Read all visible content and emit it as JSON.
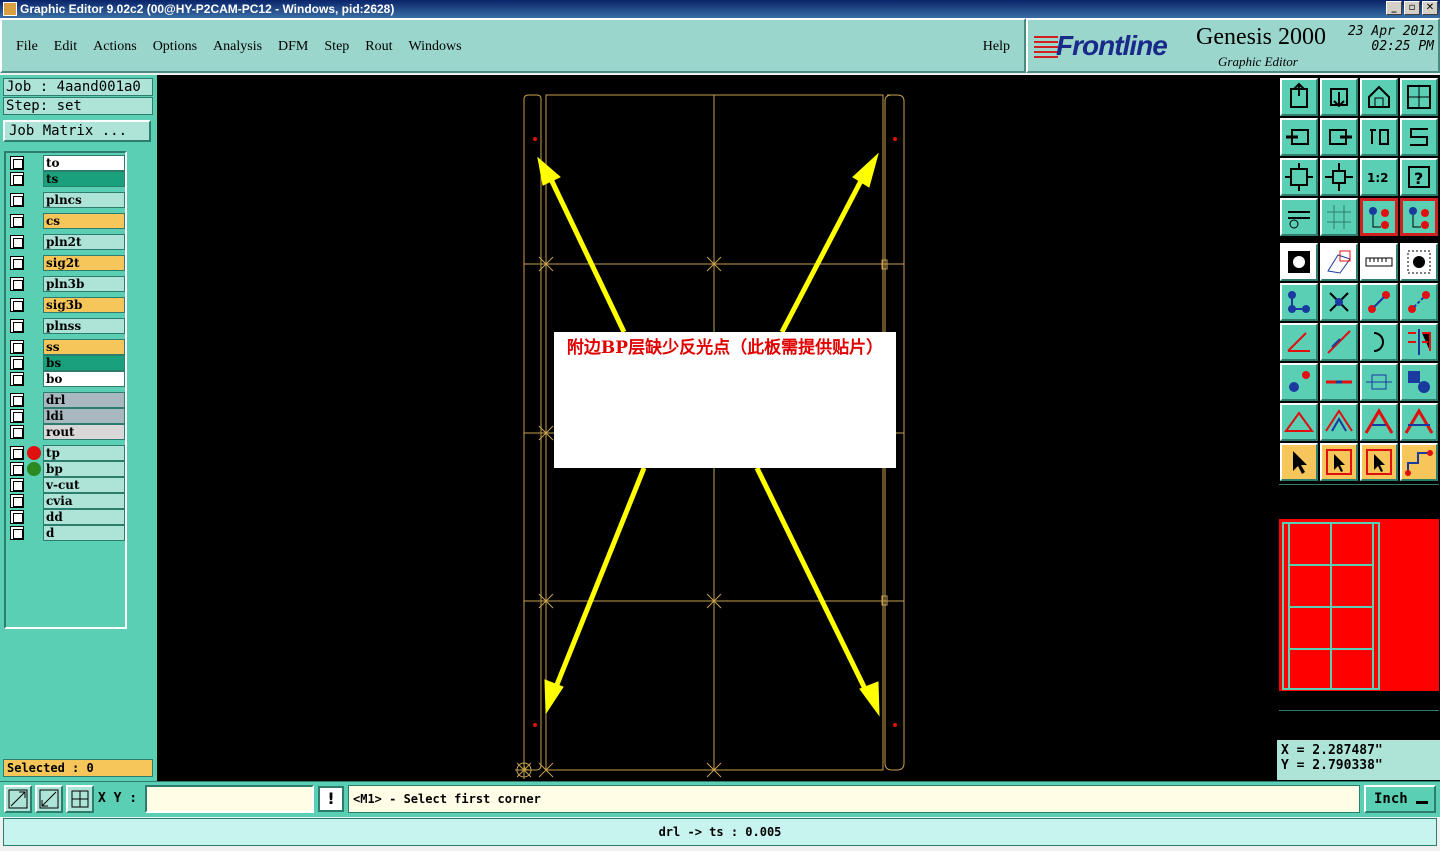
{
  "window": {
    "title": "Graphic Editor 9.02c2 (00@HY-P2CAM-PC12 - Windows, pid:2628)",
    "controls": [
      "_",
      "▫",
      "✕"
    ]
  },
  "menu": {
    "items": [
      "File",
      "Edit",
      "Actions",
      "Options",
      "Analysis",
      "DFM",
      "Step",
      "Rout",
      "Windows"
    ],
    "help": "Help"
  },
  "brand": {
    "logo": "Frontline",
    "product": "Genesis 2000",
    "subtitle": "Graphic Editor",
    "date": "23 Apr 2012",
    "time": "02:25 PM"
  },
  "job": {
    "job_line": "Job : 4aand001a0",
    "step_line": "Step: set",
    "matrix_button": "Job Matrix ..."
  },
  "layers": [
    {
      "name": "to",
      "color": "#ffffff",
      "marker": ""
    },
    {
      "name": "ts",
      "color": "#1aa07a",
      "marker": ""
    },
    {
      "name": "plncs",
      "color": "#aee4d8",
      "marker": ""
    },
    {
      "name": "cs",
      "color": "#f6c65a",
      "marker": ""
    },
    {
      "name": "pln2t",
      "color": "#aee4d8",
      "marker": ""
    },
    {
      "name": "sig2t",
      "color": "#f6c65a",
      "marker": ""
    },
    {
      "name": "pln3b",
      "color": "#aee4d8",
      "marker": ""
    },
    {
      "name": "sig3b",
      "color": "#f6c65a",
      "marker": ""
    },
    {
      "name": "plnss",
      "color": "#aee4d8",
      "marker": ""
    },
    {
      "name": "ss",
      "color": "#f6c65a",
      "marker": ""
    },
    {
      "name": "bs",
      "color": "#1aa07a",
      "marker": ""
    },
    {
      "name": "bo",
      "color": "#ffffff",
      "marker": ""
    },
    {
      "name": "drl",
      "color": "#a8b8c0",
      "marker": ""
    },
    {
      "name": "ldi",
      "color": "#a8b8c0",
      "marker": ""
    },
    {
      "name": "rout",
      "color": "#d8d8d8",
      "marker": ""
    },
    {
      "name": "tp",
      "color": "#aee4d8",
      "marker": "#e01010"
    },
    {
      "name": "bp",
      "color": "#aee4d8",
      "marker": "#2a8a20"
    },
    {
      "name": "v-cut",
      "color": "#aee4d8",
      "marker": ""
    },
    {
      "name": "cvia",
      "color": "#aee4d8",
      "marker": ""
    },
    {
      "name": "dd",
      "color": "#aee4d8",
      "marker": ""
    },
    {
      "name": "d",
      "color": "#aee4d8",
      "marker": ""
    }
  ],
  "selected": "Selected : 0",
  "annotation": {
    "text": "附边BP层缺少反光点（此板需提供贴片）"
  },
  "coords": {
    "x": "X = 2.287487\"",
    "y": "Y = 2.790338\""
  },
  "bottom": {
    "xy_label": "X Y :",
    "xy_value": "",
    "bang": "!",
    "prompt": "<M1> - Select first corner",
    "unit": "Inch"
  },
  "status": "drl -> ts : 0.005",
  "colors": {
    "accent": "#5acfb4",
    "board_outline": "#c8a050",
    "arrow": "#ffff00",
    "note_text": "#e00000",
    "minimap_fill": "#ff0000"
  }
}
